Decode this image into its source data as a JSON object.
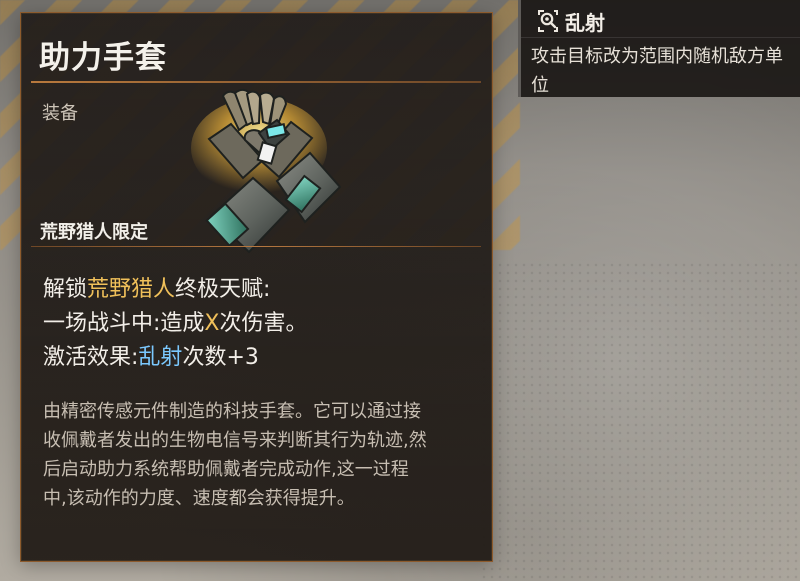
{
  "item": {
    "title": "助力手套",
    "category": "装备",
    "limited_label": "荒野猎人限定",
    "effects": {
      "line1_prefix": "解锁",
      "line1_highlight": "荒野猎人",
      "line1_suffix": "终极天赋:",
      "line2_prefix": "一场战斗中:造成",
      "line2_highlight": "X",
      "line2_suffix": "次伤害。",
      "line3_prefix": "激活效果:",
      "line3_highlight": "乱射",
      "line3_suffix": "次数+3"
    },
    "flavor_lines": [
      "由精密传感元件制造的科技手套。它可以通过接",
      "收佩戴者发出的生物电信号来判断其行为轨迹,然",
      "后启动助力系统帮助佩戴者完成动作,这一过程",
      "中,该动作的力度、速度都会获得提升。"
    ],
    "icon": "gloves-icon"
  },
  "tooltip": {
    "title": "乱射",
    "icon": "volley-icon",
    "text": "攻击目标改为范围内随机敌方单位"
  },
  "colors": {
    "accent_gold": "#f0c05a",
    "accent_blue": "#7bc9ff",
    "card_border": "#8d5b2d"
  }
}
